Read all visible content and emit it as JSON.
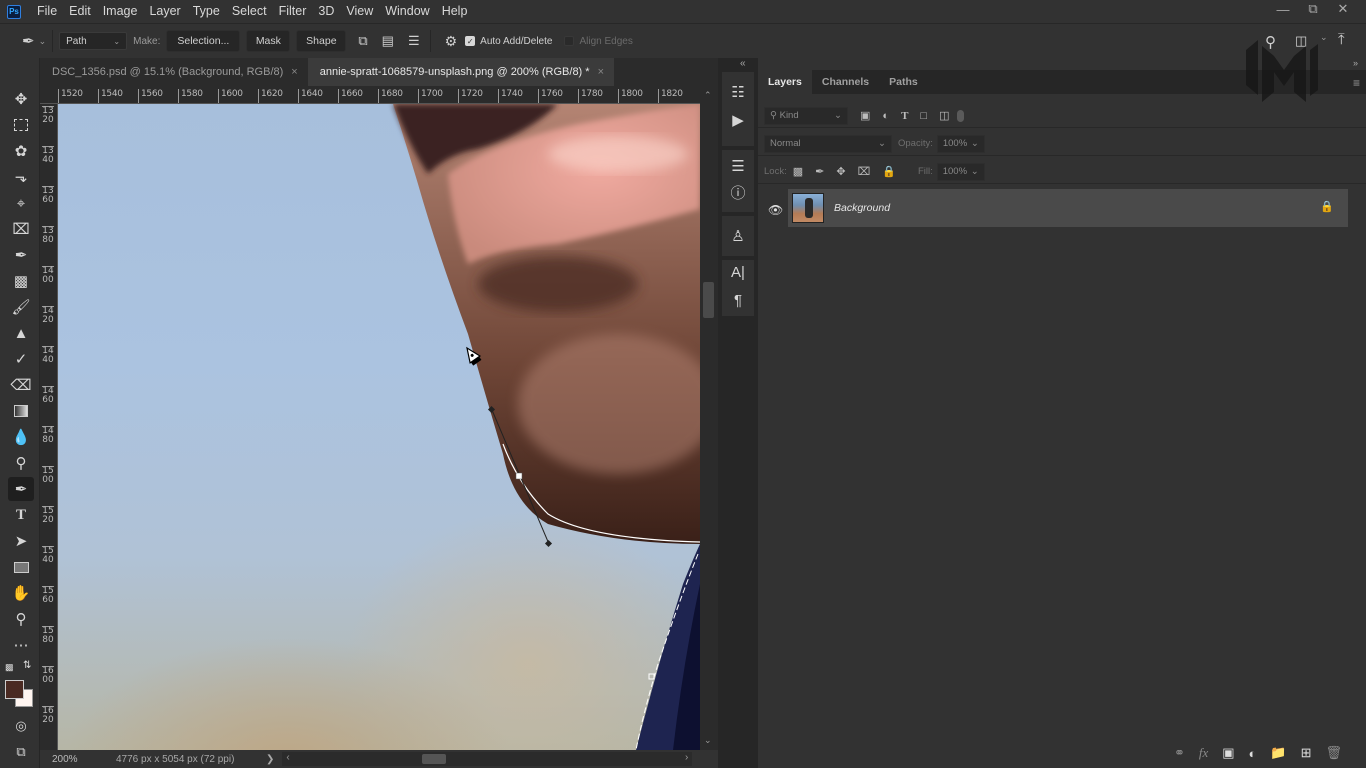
{
  "app": {
    "logo": "Ps"
  },
  "menu": [
    "File",
    "Edit",
    "Image",
    "Layer",
    "Type",
    "Select",
    "Filter",
    "3D",
    "View",
    "Window",
    "Help"
  ],
  "window_controls": {
    "minimize": "minimize-icon",
    "restore": "restore-icon",
    "close": "close-icon"
  },
  "options_bar": {
    "tool_icon": "pen-tool-icon",
    "mode_value": "Path",
    "make_label": "Make:",
    "selection_button": "Selection...",
    "mask_button": "Mask",
    "shape_button": "Shape",
    "auto_add_delete": {
      "label": "Auto Add/Delete",
      "checked": true
    },
    "align_edges": {
      "label": "Align Edges",
      "checked": false
    }
  },
  "tabs": [
    {
      "label": "DSC_1356.psd @ 15.1% (Background, RGB/8)",
      "active": false
    },
    {
      "label": "annie-spratt-1068579-unsplash.png @ 200% (RGB/8) *",
      "active": true
    }
  ],
  "rulers": {
    "horizontal": [
      "1520",
      "1540",
      "1560",
      "1580",
      "1600",
      "1620",
      "1640",
      "1660",
      "1680",
      "1700",
      "1720",
      "1740",
      "1760",
      "1780",
      "1800",
      "1820"
    ],
    "vertical": [
      "1320",
      "1340",
      "1360",
      "1380",
      "1400",
      "1420",
      "1440",
      "1460",
      "1480",
      "1500",
      "1520",
      "1540",
      "1560",
      "1580",
      "1600",
      "1620"
    ]
  },
  "tools": [
    "move-tool",
    "marquee-tool",
    "lasso-tool",
    "object-selection-tool",
    "crop-tool",
    "frame-tool",
    "eyedropper-tool",
    "spot-healing-tool",
    "brush-tool",
    "clone-stamp-tool",
    "history-brush-tool",
    "eraser-tool",
    "gradient-tool",
    "blur-tool",
    "dodge-tool",
    "pen-tool",
    "type-tool",
    "path-selection-tool",
    "rectangle-tool",
    "hand-tool",
    "zoom-tool",
    "edit-toolbar"
  ],
  "colors": {
    "foreground": "#4a2a22",
    "background": "#fff5f0",
    "accent": "#31a8ff"
  },
  "status": {
    "zoom": "200%",
    "doc_info": "4776 px x 5054 px (72 ppi)"
  },
  "panel": {
    "tabs": [
      {
        "label": "Layers",
        "active": true
      },
      {
        "label": "Channels",
        "active": false
      },
      {
        "label": "Paths",
        "active": false
      }
    ],
    "filter_kind": "Kind",
    "blend_mode": "Normal",
    "opacity_label": "Opacity:",
    "opacity_value": "100%",
    "lock_label": "Lock:",
    "fill_label": "Fill:",
    "fill_value": "100%",
    "layers": [
      {
        "name": "Background",
        "visible": true,
        "locked": true
      }
    ]
  }
}
